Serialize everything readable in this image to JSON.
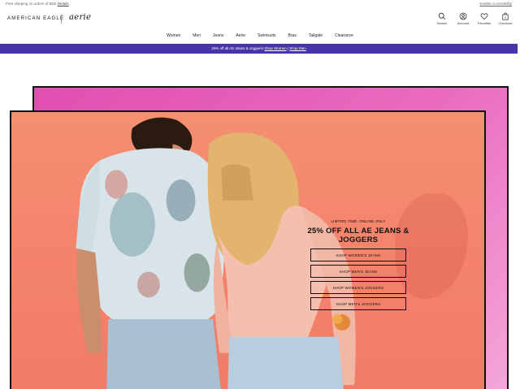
{
  "utility": {
    "promo_text": "Free shipping on orders of $50!",
    "promo_link": "Details",
    "accessibility": "Enable Accessibility"
  },
  "header": {
    "logo_ae": "AMERICAN EAGLE",
    "logo_aerie": "aerie",
    "icons": {
      "search": "Search",
      "account": "Account",
      "favorites": "Favorites",
      "checkout": "Checkout",
      "bag_count": "0"
    }
  },
  "nav": {
    "items": [
      "Women",
      "Men",
      "Jeans",
      "Aerie",
      "Swimsuits",
      "Bras",
      "Tailgate",
      "Clearance"
    ]
  },
  "banner": {
    "text": "25% off all AE Jeans & Joggers!",
    "link1": "Shop Women",
    "link2": "Shop Men"
  },
  "hero": {
    "eyebrow": "LIMITED TIME. ONLINE ONLY",
    "headline": "25% OFF ALL AE JEANS & JOGGERS",
    "ctas": [
      "SHOP WOMEN'S JEANS",
      "SHOP MEN'S JEANS",
      "SHOP WOMEN'S JOGGERS",
      "SHOP MEN'S JOGGERS"
    ]
  },
  "colors": {
    "banner": "#4636a8",
    "pink_panel": "#e04fb0",
    "coral_panel": "#f4836c"
  }
}
